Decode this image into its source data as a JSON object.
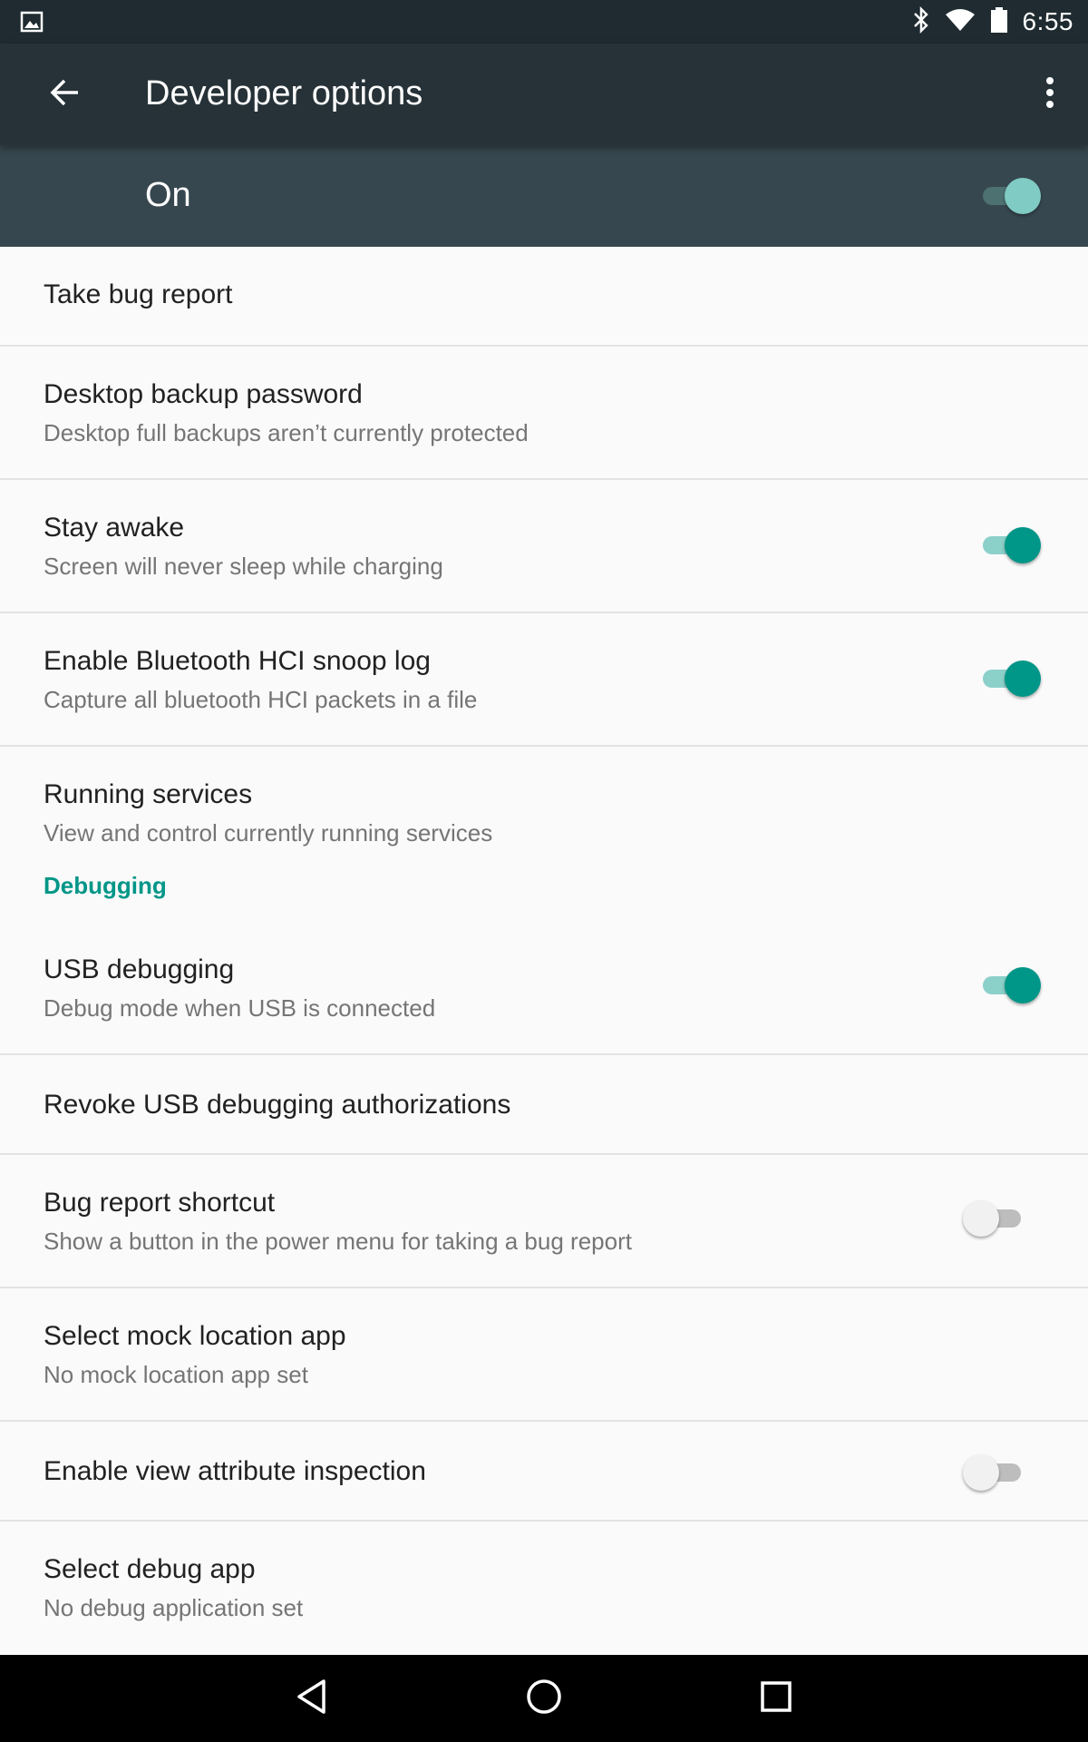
{
  "status_bar": {
    "time": "6:55",
    "icons": [
      "image-icon",
      "bluetooth-icon",
      "wifi-icon",
      "battery-icon"
    ]
  },
  "app_bar": {
    "title": "Developer options",
    "back_icon": "arrow-back-icon",
    "overflow_icon": "more-vert-icon"
  },
  "master_switch": {
    "label": "On",
    "checked": true
  },
  "items": [
    {
      "title": "Take bug report"
    },
    {
      "title": "Desktop backup password",
      "subtitle": "Desktop full backups aren’t currently protected"
    },
    {
      "title": "Stay awake",
      "subtitle": "Screen will never sleep while charging",
      "toggle": true
    },
    {
      "title": "Enable Bluetooth HCI snoop log",
      "subtitle": "Capture all bluetooth HCI packets in a file",
      "toggle": true
    },
    {
      "title": "Running services",
      "subtitle": "View and control currently running services"
    }
  ],
  "debugging": {
    "header": "Debugging",
    "items": [
      {
        "title": "USB debugging",
        "subtitle": "Debug mode when USB is connected",
        "toggle": true
      },
      {
        "title": "Revoke USB debugging authorizations"
      },
      {
        "title": "Bug report shortcut",
        "subtitle": "Show a button in the power menu for taking a bug report",
        "toggle": false
      },
      {
        "title": "Select mock location app",
        "subtitle": "No mock location app set"
      },
      {
        "title": "Enable view attribute inspection",
        "toggle": false
      },
      {
        "title": "Select debug app",
        "subtitle": "No debug application set"
      }
    ]
  },
  "nav_bar": {
    "icons": [
      "back-triangle-icon",
      "home-circle-icon",
      "recents-square-icon"
    ]
  },
  "colors": {
    "accent": "#009688",
    "app_bar": "#263238",
    "master_bar": "#37474f",
    "status_bar": "#1f2b30"
  }
}
